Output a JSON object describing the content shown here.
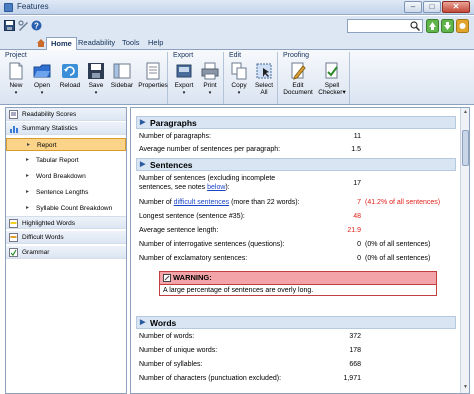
{
  "window": {
    "title": "Features",
    "minimize": "–",
    "maximize": "□",
    "close": "✕"
  },
  "search": {
    "placeholder": "",
    "value": ""
  },
  "tabs": [
    "Home",
    "Readability",
    "Tools",
    "Help"
  ],
  "ribbon": {
    "groups": [
      {
        "label": "Project",
        "buttons": [
          "New",
          "Open",
          "Reload",
          "Save",
          "Sidebar",
          "Properties"
        ]
      },
      {
        "label": "Export",
        "buttons": [
          "Export",
          "Print"
        ]
      },
      {
        "label": "Edit",
        "buttons": [
          "Copy",
          "Select All"
        ]
      },
      {
        "label": "Proofing",
        "buttons": [
          "Edit Document",
          "Spell Checker"
        ]
      }
    ]
  },
  "sidebar": {
    "items": [
      {
        "label": "Readability Scores"
      },
      {
        "label": "Summary Statistics"
      },
      {
        "label": "Report"
      },
      {
        "label": "Tabular Report"
      },
      {
        "label": "Word Breakdown"
      },
      {
        "label": "Sentence Lengths"
      },
      {
        "label": "Syllable Count Breakdown"
      },
      {
        "label": "Highlighted Words"
      },
      {
        "label": "Difficult Words"
      },
      {
        "label": "Grammar"
      }
    ]
  },
  "report": {
    "paragraphs": {
      "title": "Paragraphs",
      "rows": [
        {
          "label": "Number of paragraphs:",
          "value": "11"
        },
        {
          "label": "Average number of sentences per paragraph:",
          "value": "1.5"
        }
      ]
    },
    "sentences": {
      "title": "Sentences",
      "row1_label_a": "Number of sentences (excluding incomplete",
      "row1_label_b": "sentences, see notes ",
      "row1_link": "below",
      "row1_label_c": "):",
      "row1_value": "17",
      "row2_label_a": "Number of ",
      "row2_link": "difficult sentences",
      "row2_label_b": " (more than 22 words):",
      "row2_value": "7",
      "row2_extra": "(41.2% of all sentences)",
      "row3_label": "Longest sentence (sentence #35):",
      "row3_value": "48",
      "row4_label": "Average sentence length:",
      "row4_value": "21.9",
      "row5_label": "Number of interrogative sentences (questions):",
      "row5_value": "0",
      "row5_extra": "(0% of all sentences)",
      "row6_label": "Number of exclamatory sentences:",
      "row6_value": "0",
      "row6_extra": "(0% of all sentences)"
    },
    "warning": {
      "title": "WARNING:",
      "text": "A large percentage of sentences are overly long."
    },
    "words": {
      "title": "Words",
      "rows": [
        {
          "label": "Number of words:",
          "value": "372"
        },
        {
          "label": "Number of unique words:",
          "value": "178"
        },
        {
          "label": "Number of syllables:",
          "value": "668"
        },
        {
          "label": "Number of characters (punctuation excluded):",
          "value": "1,971"
        }
      ]
    }
  }
}
